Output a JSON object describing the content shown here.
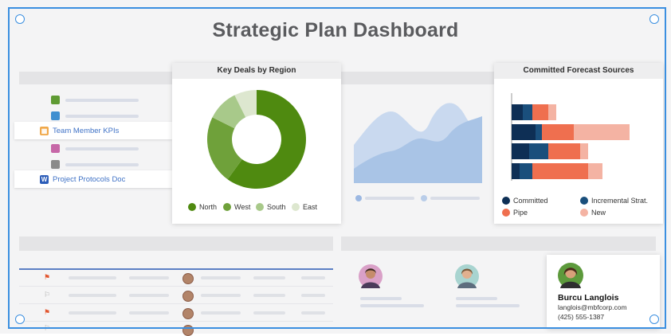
{
  "dashboard": {
    "title": "Strategic Plan Dashboard"
  },
  "left_list": {
    "items": [
      {
        "label": "Team Member KPIs",
        "icon": "sheet-icon",
        "color": "#f0a84a"
      },
      {
        "label": "Project Protocols Doc",
        "icon": "word-doc-icon",
        "color": "#2b5cb8"
      }
    ],
    "swatches": [
      "#5f9b33",
      "#3f8fd0",
      "#c667a7",
      "#8a8a8a"
    ]
  },
  "key_deals": {
    "title": "Key Deals by Region",
    "legend": [
      {
        "label": "North",
        "color": "#4f8a10"
      },
      {
        "label": "West",
        "color": "#6fa13a"
      },
      {
        "label": "South",
        "color": "#a8c98a"
      },
      {
        "label": "East",
        "color": "#dde7cf"
      }
    ]
  },
  "forecast": {
    "title": "Committed Forecast Sources",
    "legend": [
      {
        "label": "Committed",
        "color": "#0e2f55"
      },
      {
        "label": "Incremental Strat.",
        "color": "#1a4f7c"
      },
      {
        "label": "Pipe",
        "color": "#ef6f4f"
      },
      {
        "label": "New",
        "color": "#f4b3a3"
      }
    ]
  },
  "contact": {
    "name": "Burcu Langlois",
    "email": "langlois@mbfcorp.com",
    "phone": "(425) 555-1387"
  },
  "colors": {
    "selection": "#3b8fe0",
    "area_back": "#c9d9ef",
    "area_front": "#a9c4e6"
  }
}
